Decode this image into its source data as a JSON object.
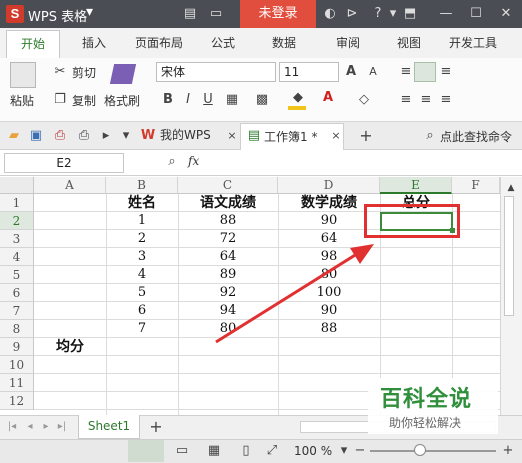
{
  "titlebar": {
    "app_title": "WPS 表格",
    "login": "未登录"
  },
  "ribbon": {
    "tabs": [
      "开始",
      "插入",
      "页面布局",
      "公式",
      "数据",
      "审阅",
      "视图",
      "开发工具"
    ]
  },
  "toolbar": {
    "cut": "剪切",
    "paste": "粘贴",
    "copy": "复制",
    "format_painter": "格式刷",
    "font_name": "宋体",
    "font_size": "11"
  },
  "doc_tabs": {
    "wps": "我的WPS",
    "book": "工作簿1 *",
    "search": "点此查找命令"
  },
  "formula_bar": {
    "cell_ref": "E2",
    "fx": "fx"
  },
  "columns": [
    "A",
    "B",
    "C",
    "D",
    "E",
    "F"
  ],
  "rows": [
    "1",
    "2",
    "3",
    "4",
    "5",
    "6",
    "7",
    "8",
    "9",
    "10",
    "11",
    "12"
  ],
  "sheet": {
    "header": {
      "b": "姓名",
      "c": "语文成绩",
      "d": "数学成绩",
      "e": "总分"
    },
    "data": [
      {
        "b": "1",
        "c": "88",
        "d": "90"
      },
      {
        "b": "2",
        "c": "72",
        "d": "64"
      },
      {
        "b": "3",
        "c": "64",
        "d": "98"
      },
      {
        "b": "4",
        "c": "89",
        "d": "80"
      },
      {
        "b": "5",
        "c": "92",
        "d": "100"
      },
      {
        "b": "6",
        "c": "94",
        "d": "90"
      },
      {
        "b": "7",
        "c": "80",
        "d": "88"
      }
    ],
    "avg_label": "均分"
  },
  "sheet_tabs": {
    "active": "Sheet1"
  },
  "status": {
    "zoom": "100 %"
  },
  "watermark": {
    "title": "百科全说",
    "sub": "助你轻松解决"
  },
  "colors": {
    "accent_green": "#2d7a2d",
    "annotation_red": "#e03030",
    "login_red": "#e24e3e"
  }
}
